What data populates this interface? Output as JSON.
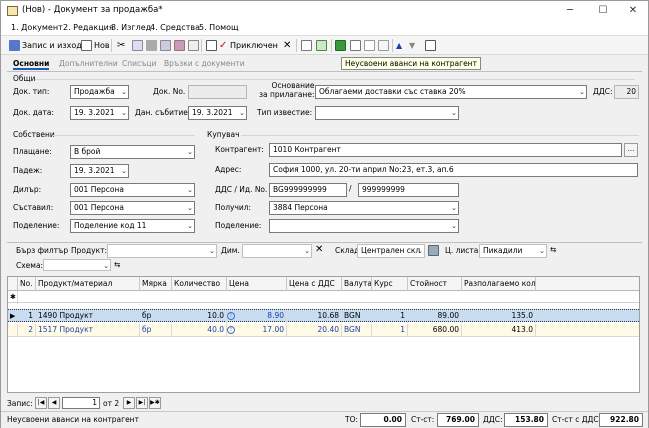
{
  "window": {
    "title": "(Нов) - Документ за продажба*",
    "minimize": "─",
    "maximize": "☐",
    "close": "✕"
  },
  "menu": [
    "1. Документ",
    "2. Редакция",
    "3. Изглед",
    "4. Средства",
    "5. Помощ"
  ],
  "toolbar": {
    "save_exit": "Запис и изход",
    "new": "Нов",
    "post": "Приключен"
  },
  "tooltip": "Неусвоени аванси на контрагент",
  "tabs": [
    "Основни",
    "Допълнителни",
    "Списъци",
    "Връзки с документи"
  ],
  "general": {
    "group": "Общи",
    "doc_type_label": "Док. тип:",
    "doc_type": "Продажба",
    "doc_no_label": "Док. No.",
    "doc_no": "",
    "basis_label": "Основание\nза прилагане:",
    "basis": "Облагаеми доставки със ставка 20%",
    "vat_label": "ДДС:",
    "vat": "20",
    "doc_date_label": "Док. дата:",
    "doc_date": "19.  3.2021",
    "event_date_label": "Дан. събитие:",
    "event_date": "19.  3.2021",
    "notice_label": "Тип известие:",
    "notice": ""
  },
  "own": {
    "group": "Собствени",
    "payment_label": "Плащане:",
    "payment": "В брой",
    "due_label": "Падеж:",
    "due": "19.  3.2021",
    "dealer_label": "Дилър:",
    "dealer": "001 Персона",
    "author_label": "Съставил:",
    "author": "001 Персона",
    "division_label": "Поделение:",
    "division": "Поделение код 11"
  },
  "buyer": {
    "group": "Купувач",
    "partner_label": "Контрагент:",
    "partner": "1010 Контрагент",
    "address_label": "Адрес:",
    "address": "София 1000, ул. 20-ти април No:23, ет.3, ап.6",
    "vat_id_label": "ДДС / Ид. No.",
    "vat_no": "BG999999999",
    "id_no": "999999999",
    "receiver_label": "Получил:",
    "receiver": "3884 Персона",
    "division_label": "Поделение:",
    "division": ""
  },
  "filter": {
    "quick_label": "Бърз филтър",
    "product_label": "Продукт:",
    "product": "",
    "dim_label": "Дим.",
    "dim": "",
    "store_label": "Склад:",
    "store": "Централен скл",
    "price_list_label": "Ц. листа:",
    "price_list": "Пикадили",
    "scheme_label": "Схема:",
    "scheme": ""
  },
  "grid": {
    "headers": [
      "No.",
      "Продукт/материал",
      "Мярка",
      "Количество",
      "Цена",
      "Цена с ДДС",
      "Валута",
      "Курс",
      "Стойност",
      "Разполагаемо кол."
    ],
    "rows": [
      {
        "no": "1",
        "product": "1490 Продукт",
        "unit": "бр",
        "qty": "10.0",
        "price": "8.90",
        "price_vat": "10.68",
        "currency": "BGN",
        "rate": "1",
        "value": "89.00",
        "avail": "135.0"
      },
      {
        "no": "2",
        "product": "1517 Продукт",
        "unit": "бр",
        "qty": "40.0",
        "price": "17.00",
        "price_vat": "20.40",
        "currency": "BGN",
        "rate": "1",
        "value": "680.00",
        "avail": "413.0"
      }
    ]
  },
  "nav": {
    "label": "Запис:",
    "current": "1",
    "of": "от 2"
  },
  "status": {
    "message": "Неусвоени аванси на контрагент",
    "to_label": "ТО:",
    "to": "0.00",
    "st_label": "Ст-ст:",
    "st": "769.00",
    "vat_label": "ДДС:",
    "vat": "153.80",
    "total_label": "Ст-ст с ДДС:",
    "total": "922.80"
  },
  "colors": {
    "selected_row": "#c8ddf2",
    "edited_row": "#fffbe6",
    "link_blue": "#1a3fb0"
  }
}
